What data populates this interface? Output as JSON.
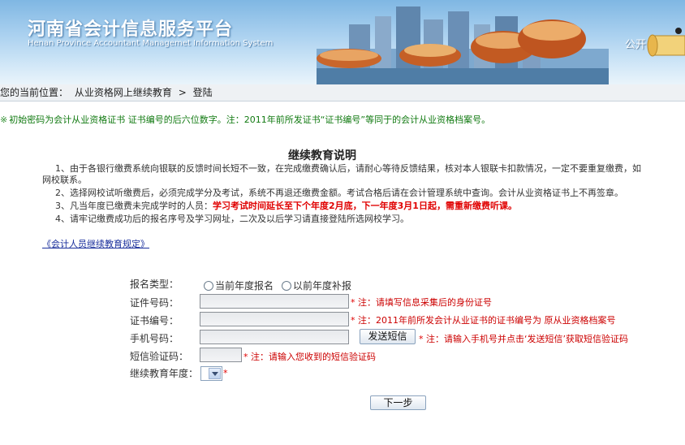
{
  "banner": {
    "title": "河南省会计信息服务平台",
    "subtitle": "Henan  Province Accountant Managemet Information System",
    "right_text": "公开"
  },
  "breadcrumb": {
    "prefix": "您的当前位置：",
    "item1": "从业资格网上继续教育",
    "separator": ">",
    "item2": "登陆"
  },
  "notice": {
    "mark": "※",
    "text": "初始密码为会计从业资格证书 证书编号的后六位数字。注：2011年前所发证书“证书编号”等同于的会计从业资格档案号。"
  },
  "instructions": {
    "title": "继续教育说明",
    "item1_line1": "1、由于各银行缴费系统向银联的反馈时间长短不一致，在完成缴费确认后，请耐心等待反馈结果，核对本人银联卡扣款情况，一定不要重复缴费，如",
    "item1_line2": "网校联系。",
    "item2": "2、选择网校试听缴费后，必须完成学分及考试，系统不再退还缴费金额。考试合格后请在会计管理系统中查询。会计从业资格证书上不再签章。",
    "item3_prefix": "3、凡当年度已缴费未完成学时的人员：",
    "item3_red": "学习考试时间延长至下个年度2月底，下一年度3月1日起，需重新缴费听课。",
    "item4": "4、请牢记缴费成功后的报名序号及学习网址，二次及以后学习请直接登陆所选网校学习。"
  },
  "rule_link": "《会计人员继续教育规定》",
  "form": {
    "enroll_type_label": "报名类型：",
    "option_current": "当前年度报名",
    "option_previous": "以前年度补报",
    "id_label": "证件号码：",
    "id_hint": "注：请填写信息采集后的身份证号",
    "cert_label": "证书编号：",
    "cert_hint": "注：2011年前所发会计从业证书的证书编号为 原从业资格档案号",
    "phone_label": "手机号码：",
    "send_sms_button": "发送短信",
    "phone_hint": "注：请输入手机号并点击‘发送短信’获取短信验证码",
    "sms_code_label": "短信验证码：",
    "sms_code_hint": "注：请输入您收到的短信验证码",
    "year_label": "继续教育年度：",
    "star": "*",
    "next_button": "下一步"
  }
}
